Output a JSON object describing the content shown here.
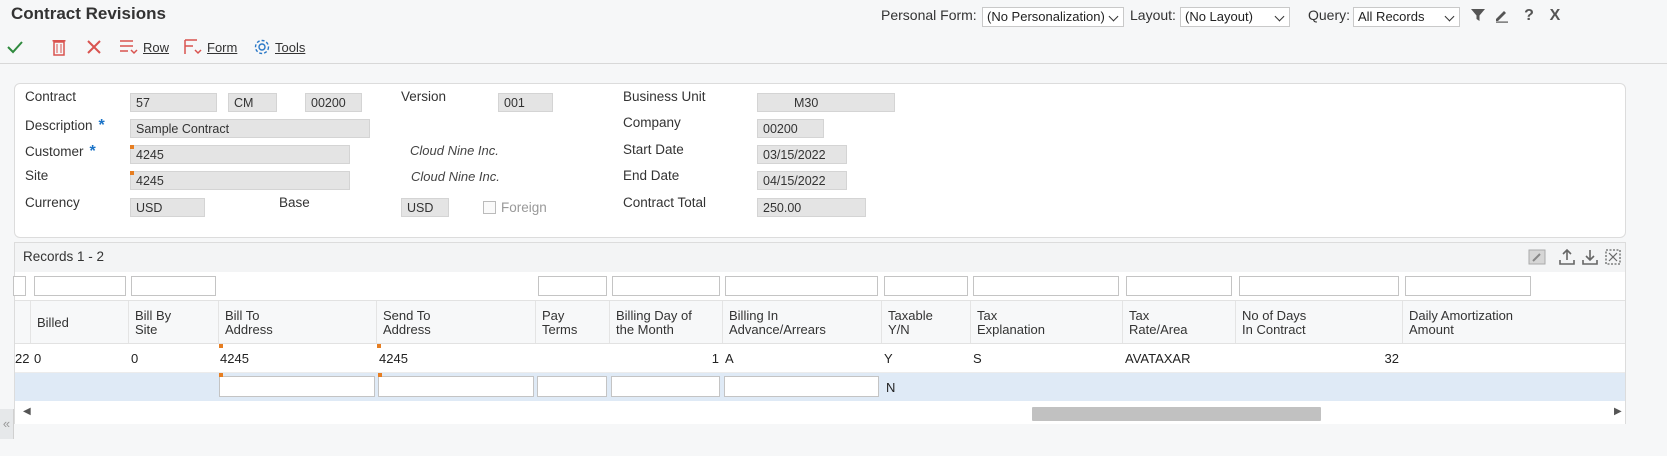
{
  "title": "Contract Revisions",
  "header": {
    "personal_form_label": "Personal Form:",
    "personal_form_value": "(No Personalization)",
    "layout_label": "Layout:",
    "layout_value": "(No Layout)",
    "query_label": "Query:",
    "query_value": "All Records"
  },
  "toolbar": {
    "row_label": "Row",
    "form_label": "Form",
    "tools_label": "Tools"
  },
  "form": {
    "contract_label": "Contract",
    "contract_number": "57",
    "contract_type": "CM",
    "contract_company": "00200",
    "version_label": "Version",
    "version_value": "001",
    "business_unit_label": "Business Unit",
    "business_unit_value": "M30",
    "description_label": "Description",
    "description_value": "Sample Contract",
    "company_label": "Company",
    "company_value": "00200",
    "customer_label": "Customer",
    "customer_value": "4245",
    "customer_name": "Cloud Nine Inc.",
    "start_date_label": "Start Date",
    "start_date_value": "03/15/2022",
    "site_label": "Site",
    "site_value": "4245",
    "site_name": "Cloud Nine Inc.",
    "end_date_label": "End Date",
    "end_date_value": "04/15/2022",
    "currency_label": "Currency",
    "currency_value": "USD",
    "base_label": "Base",
    "base_value": "USD",
    "foreign_label": "Foreign",
    "contract_total_label": "Contract Total",
    "contract_total_value": "250.00",
    "required_marker": "*"
  },
  "grid": {
    "records_label": "Records 1 - 2",
    "columns": [
      "Billed",
      "Bill By\nSite",
      "Bill To\nAddress",
      "Send To\nAddress",
      "Pay\nTerms",
      "Billing Day of\nthe Month",
      "Billing In\nAdvance/Arrears",
      "Taxable\nY/N",
      "Tax\nExplanation",
      "Tax\nRate/Area",
      "No of Days\nIn Contract",
      "Daily Amortization\nAmount"
    ],
    "row1": {
      "leading": "22",
      "billed": "0",
      "bill_by_site": "0",
      "bill_to_address": "4245",
      "send_to_address": "4245",
      "pay_terms": "",
      "billing_day": "1",
      "billing_in": "A",
      "taxable": "Y",
      "tax_explanation": "S",
      "tax_rate_area": "AVATAXAR",
      "days_in_contract": "32",
      "daily_amortization": ""
    },
    "row2": {
      "taxable": "N"
    }
  }
}
